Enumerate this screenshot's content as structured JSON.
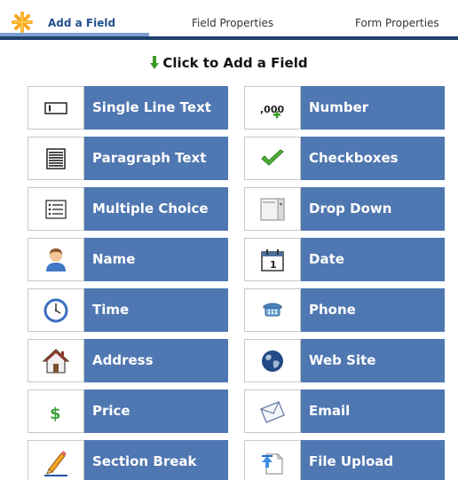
{
  "tabs": {
    "add_field": "Add a Field",
    "field_properties": "Field Properties",
    "form_properties": "Form Properties"
  },
  "heading": "Click to Add a Field",
  "colors": {
    "accent_blue": "#4f77b1",
    "tab_active_text": "#1f4f8a",
    "tab_underline": "#1f3f6e",
    "asterisk_orange": "#f7a823",
    "arrow_green": "#3a9b2a"
  },
  "fields": [
    {
      "label": "Single Line Text",
      "icon": "single-line-text-icon"
    },
    {
      "label": "Number",
      "icon": "number-icon"
    },
    {
      "label": "Paragraph Text",
      "icon": "paragraph-text-icon"
    },
    {
      "label": "Checkboxes",
      "icon": "checkmark-icon"
    },
    {
      "label": "Multiple Choice",
      "icon": "list-icon"
    },
    {
      "label": "Drop Down",
      "icon": "dropdown-icon"
    },
    {
      "label": "Name",
      "icon": "person-icon"
    },
    {
      "label": "Date",
      "icon": "calendar-icon"
    },
    {
      "label": "Time",
      "icon": "clock-icon"
    },
    {
      "label": "Phone",
      "icon": "phone-icon"
    },
    {
      "label": "Address",
      "icon": "house-icon"
    },
    {
      "label": "Web Site",
      "icon": "globe-icon"
    },
    {
      "label": "Price",
      "icon": "dollar-icon"
    },
    {
      "label": "Email",
      "icon": "envelope-icon"
    },
    {
      "label": "Section Break",
      "icon": "pencil-icon"
    },
    {
      "label": "File Upload",
      "icon": "file-upload-icon"
    }
  ]
}
